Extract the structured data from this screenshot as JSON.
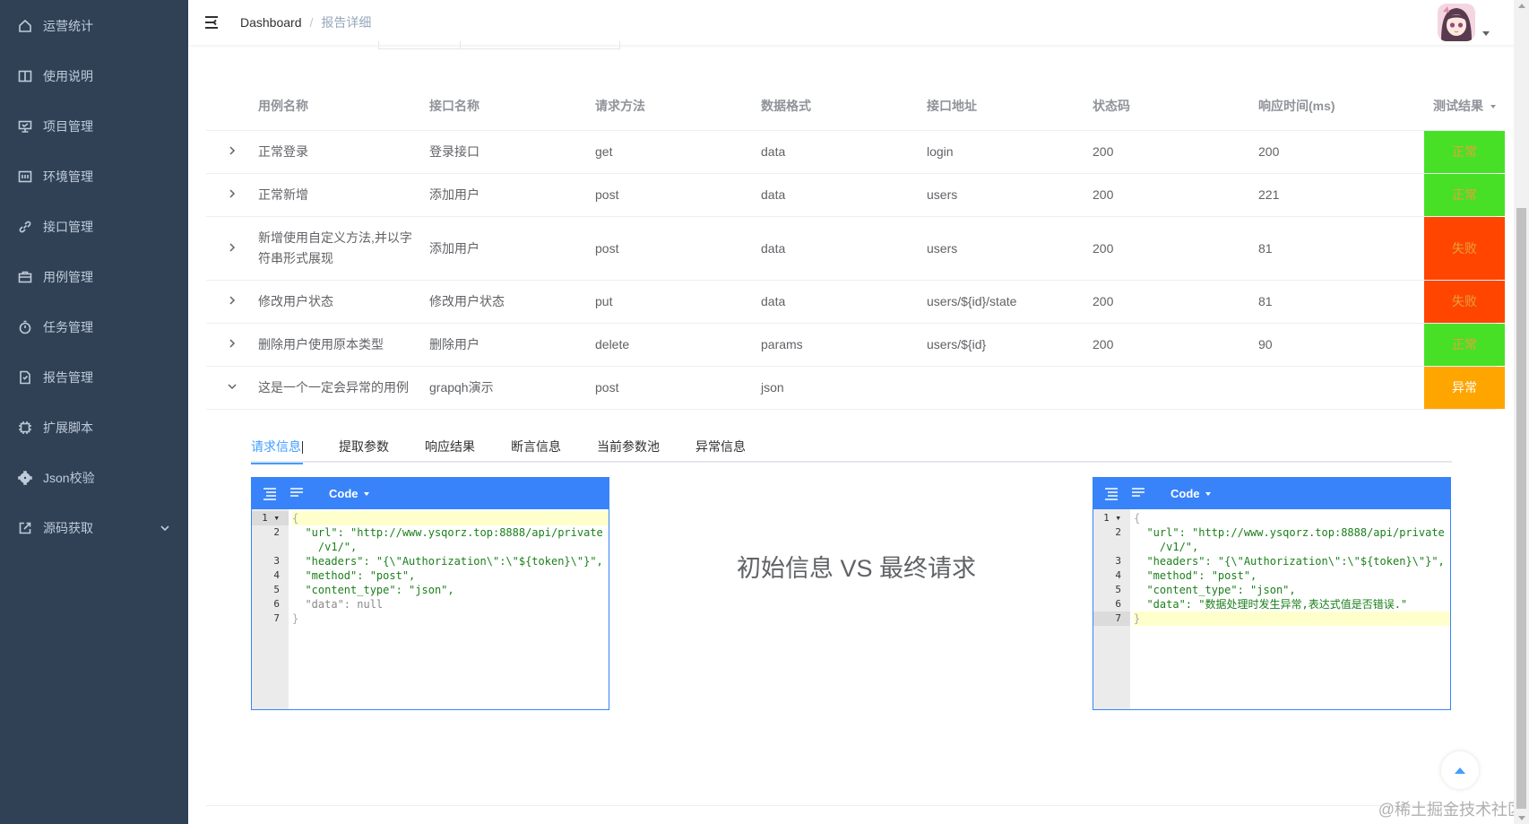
{
  "sidebar": {
    "items": [
      {
        "label": "运营统计",
        "icon": "home-icon"
      },
      {
        "label": "使用说明",
        "icon": "book-icon"
      },
      {
        "label": "项目管理",
        "icon": "monitor-icon"
      },
      {
        "label": "环境管理",
        "icon": "panel-icon"
      },
      {
        "label": "接口管理",
        "icon": "link-icon"
      },
      {
        "label": "用例管理",
        "icon": "briefcase-icon"
      },
      {
        "label": "任务管理",
        "icon": "stopwatch-icon"
      },
      {
        "label": "报告管理",
        "icon": "report-icon"
      },
      {
        "label": "扩展脚本",
        "icon": "cpu-icon"
      },
      {
        "label": "Json校验",
        "icon": "gear-icon"
      },
      {
        "label": "源码获取",
        "icon": "external-link-icon"
      }
    ]
  },
  "header": {
    "breadcrumb_home": "Dashboard",
    "breadcrumb_sep": "/",
    "breadcrumb_current": "报告详细"
  },
  "table": {
    "headers": {
      "name": "用例名称",
      "api": "接口名称",
      "method": "请求方法",
      "format": "数据格式",
      "url": "接口地址",
      "status": "状态码",
      "time": "响应时间(ms)",
      "result": "测试结果"
    },
    "rows": [
      {
        "name": "正常登录",
        "api": "登录接口",
        "method": "get",
        "format": "data",
        "url": "login",
        "status": "200",
        "time": "200",
        "result": "正常"
      },
      {
        "name": "正常新增",
        "api": "添加用户",
        "method": "post",
        "format": "data",
        "url": "users",
        "status": "200",
        "time": "221",
        "result": "正常"
      },
      {
        "name": "新增使用自定义方法,并以字符串形式展现",
        "api": "添加用户",
        "method": "post",
        "format": "data",
        "url": "users",
        "status": "200",
        "time": "81",
        "result": "失败"
      },
      {
        "name": "修改用户状态",
        "api": "修改用户状态",
        "method": "put",
        "format": "data",
        "url": "users/${id}/state",
        "status": "200",
        "time": "81",
        "result": "失败"
      },
      {
        "name": "删除用户使用原本类型",
        "api": "删除用户",
        "method": "delete",
        "format": "params",
        "url": "users/${id}",
        "status": "200",
        "time": "90",
        "result": "正常"
      },
      {
        "name": "这是一个一定会异常的用例",
        "api": "grapqh演示",
        "method": "post",
        "format": "json",
        "url": "",
        "status": "",
        "time": "",
        "result": "异常"
      }
    ]
  },
  "tabs": [
    "请求信息",
    "提取参数",
    "响应结果",
    "断言信息",
    "当前参数池",
    "异常信息"
  ],
  "editor_mode": "Code",
  "left_editor": {
    "lines": [
      {
        "no": "1",
        "text": "{"
      },
      {
        "no": "2",
        "text": "  \"url\": \"http://www.ysqorz.top:8888/api/private\n    /v1/\","
      },
      {
        "no": "3",
        "text": "  \"headers\": \"{\\\"Authorization\\\":\\\"${token}\\\"}\","
      },
      {
        "no": "4",
        "text": "  \"method\": \"post\","
      },
      {
        "no": "5",
        "text": "  \"content_type\": \"json\","
      },
      {
        "no": "6",
        "text": "  \"data\": null"
      },
      {
        "no": "7",
        "text": "}"
      }
    ]
  },
  "right_editor": {
    "lines": [
      {
        "no": "1",
        "text": "{"
      },
      {
        "no": "2",
        "text": "  \"url\": \"http://www.ysqorz.top:8888/api/private\n    /v1/\","
      },
      {
        "no": "3",
        "text": "  \"headers\": \"{\\\"Authorization\\\":\\\"${token}\\\"}\","
      },
      {
        "no": "4",
        "text": "  \"method\": \"post\","
      },
      {
        "no": "5",
        "text": "  \"content_type\": \"json\","
      },
      {
        "no": "6",
        "text": "  \"data\": \"数据处理时发生异常,表达式值是否错误.\""
      },
      {
        "no": "7",
        "text": "}"
      }
    ]
  },
  "vs_title": "初始信息 VS 最终请求",
  "watermark": "@稀土掘金技术社区",
  "colors": {
    "sidebar_bg": "#304156",
    "pass": "#47e027",
    "fail": "#ff4500",
    "error": "#ffa500",
    "editor_accent": "#3883fa",
    "tab_active": "#409eff"
  }
}
